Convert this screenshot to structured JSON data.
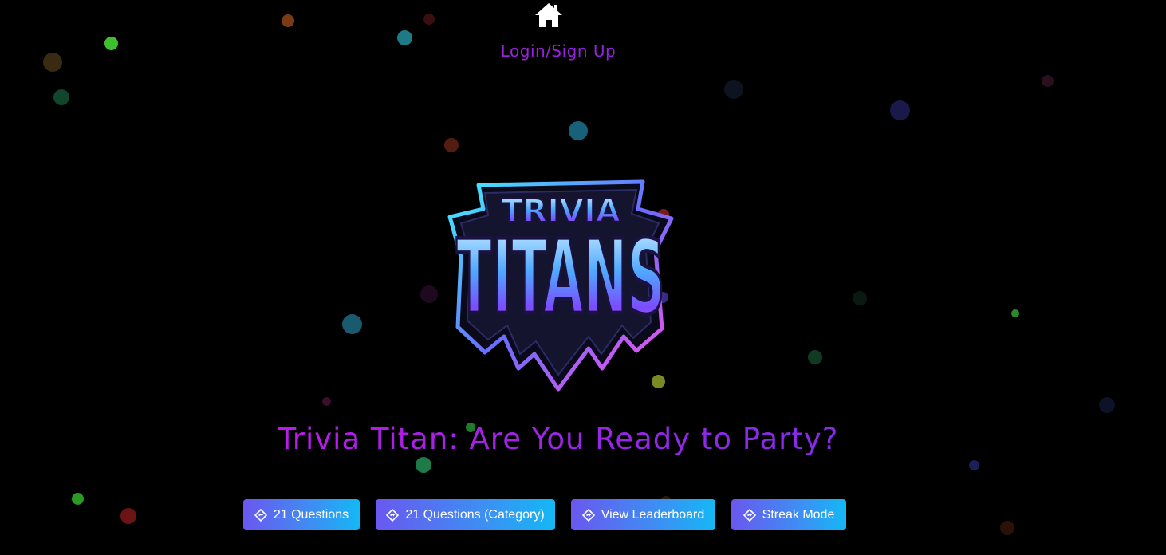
{
  "nav": {
    "home_icon": "home-icon",
    "login_label": "Login/Sign Up"
  },
  "logo": {
    "line1": "TRIVIA",
    "line2": "TITANS"
  },
  "headline": "Trivia Titan: Are You Ready to Party?",
  "actions": [
    {
      "label": "21 Questions",
      "icon": "diamond-direction-icon"
    },
    {
      "label": "21 Questions (Category)",
      "icon": "diamond-direction-icon"
    },
    {
      "label": "View Leaderboard",
      "icon": "diamond-direction-icon"
    },
    {
      "label": "Streak Mode",
      "icon": "diamond-direction-icon"
    }
  ],
  "colors": {
    "background": "#000000",
    "accent_pink": "#e010e8",
    "accent_purple": "#7a2ee8",
    "button_start": "#6a58ef",
    "button_end": "#14b8f5"
  }
}
